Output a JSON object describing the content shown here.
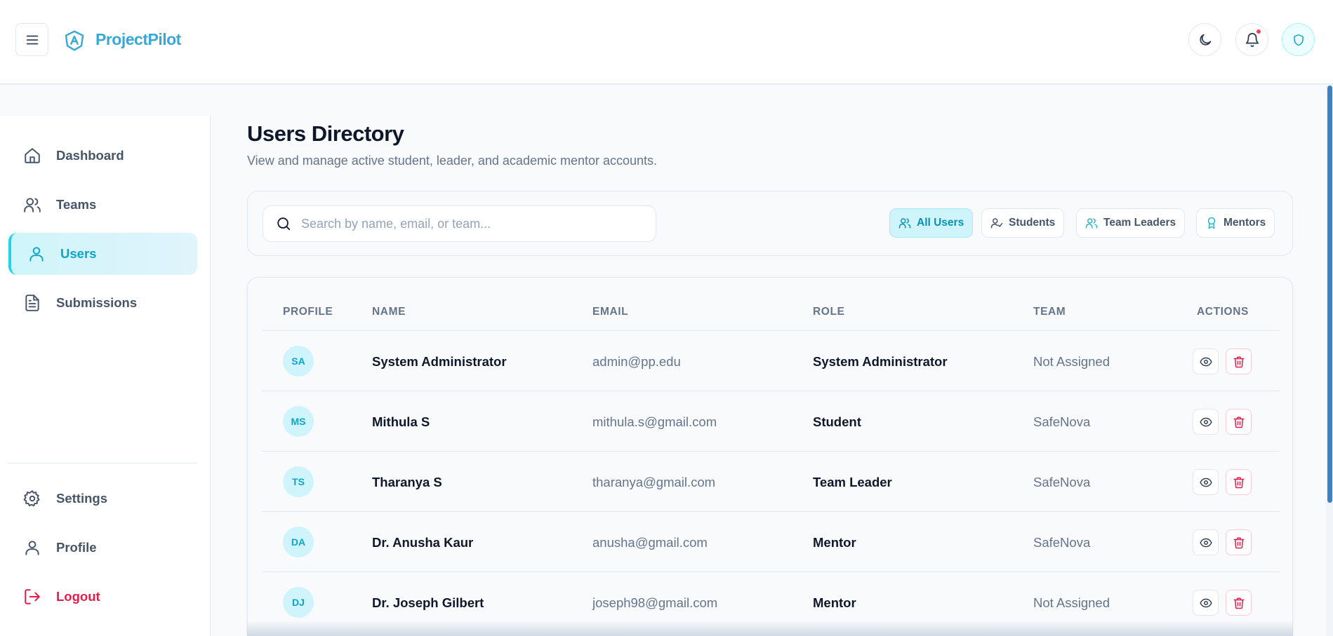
{
  "header": {
    "app_name": "ProjectPilot",
    "icons": [
      "menu-icon",
      "logo-icon",
      "moon-icon",
      "bell-icon",
      "shield-icon"
    ],
    "has_notification": true
  },
  "sidebar": {
    "items": [
      {
        "label": "Dashboard",
        "icon": "home-icon"
      },
      {
        "label": "Teams",
        "icon": "users-icon"
      },
      {
        "label": "Users",
        "icon": "user-icon",
        "active": true
      },
      {
        "label": "Submissions",
        "icon": "document-icon"
      }
    ],
    "bottom_items": [
      {
        "label": "Settings",
        "icon": "gear-icon"
      },
      {
        "label": "Profile",
        "icon": "user-icon"
      },
      {
        "label": "Logout",
        "icon": "logout-icon"
      }
    ]
  },
  "page": {
    "title": "Users Directory",
    "subtitle": "View and manage active student, leader, and academic mentor accounts."
  },
  "search": {
    "placeholder": "Search by name, email, or team...",
    "value": ""
  },
  "filters": [
    {
      "label": "All Users",
      "icon": "users-icon",
      "active": true
    },
    {
      "label": "Students",
      "icon": "user-check-icon"
    },
    {
      "label": "Team Leaders",
      "icon": "users-icon"
    },
    {
      "label": "Mentors",
      "icon": "award-icon"
    }
  ],
  "table": {
    "columns": [
      "PROFILE",
      "NAME",
      "EMAIL",
      "ROLE",
      "TEAM",
      "ACTIONS"
    ],
    "rows": [
      {
        "initials": "SA",
        "name": "System Administrator",
        "email": "admin@pp.edu",
        "role": "System Administrator",
        "team": "Not Assigned"
      },
      {
        "initials": "MS",
        "name": "Mithula S",
        "email": "mithula.s@gmail.com",
        "role": "Student",
        "team": "SafeNova"
      },
      {
        "initials": "TS",
        "name": "Tharanya S",
        "email": "tharanya@gmail.com",
        "role": "Team Leader",
        "team": "SafeNova"
      },
      {
        "initials": "DA",
        "name": "Dr. Anusha Kaur",
        "email": "anusha@gmail.com",
        "role": "Mentor",
        "team": "SafeNova"
      },
      {
        "initials": "DJ",
        "name": "Dr. Joseph Gilbert",
        "email": "joseph98@gmail.com",
        "role": "Mentor",
        "team": "Not Assigned"
      }
    ]
  },
  "colors": {
    "accent": "#22d3ee",
    "brand": "#38a8d8",
    "danger": "#e11d48"
  }
}
